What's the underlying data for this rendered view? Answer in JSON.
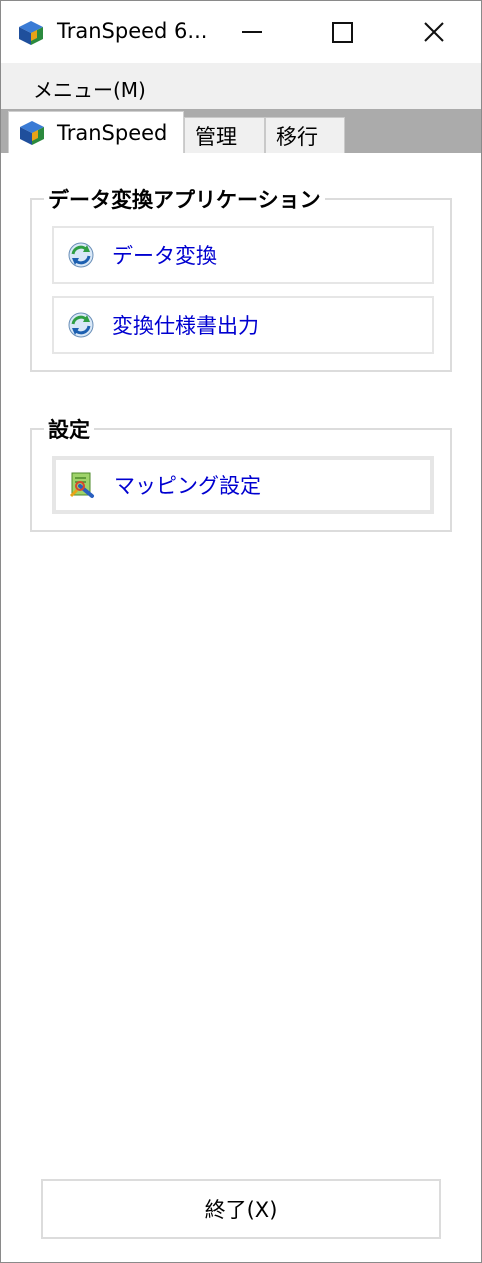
{
  "window": {
    "title": "TranSpeed 6..."
  },
  "menubar": {
    "menu_label": "メニュー(M)"
  },
  "tabs": [
    {
      "label": "TranSpeed",
      "active": true,
      "icon": "transpeed-cube-icon"
    },
    {
      "label": "管理",
      "active": false
    },
    {
      "label": "移行",
      "active": false
    }
  ],
  "groups": {
    "data_conversion": {
      "title": "データ変換アプリケーション",
      "items": [
        {
          "label": "データ変換",
          "icon": "refresh-icon"
        },
        {
          "label": "変換仕様書出力",
          "icon": "refresh-icon"
        }
      ]
    },
    "settings": {
      "title": "設定",
      "items": [
        {
          "label": "マッピング設定",
          "icon": "mapping-settings-icon"
        }
      ]
    }
  },
  "footer": {
    "exit_label": "終了(X)"
  },
  "colors": {
    "link": "#0000d0",
    "tabstrip": "#ababab",
    "menubar": "#f0f0f0"
  }
}
